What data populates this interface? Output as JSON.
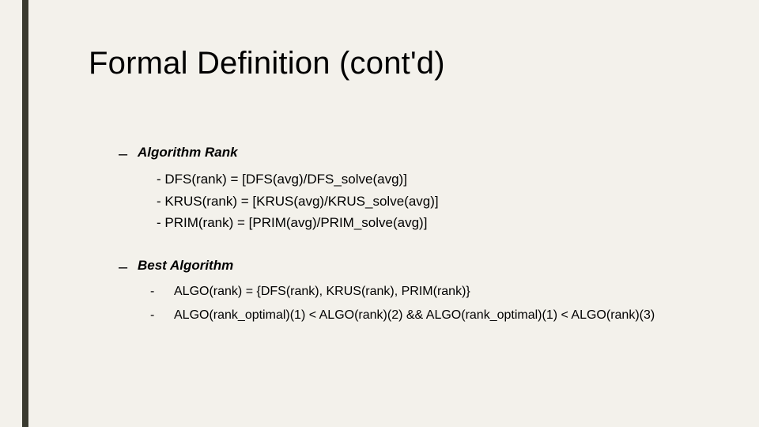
{
  "title": "Formal Definition (cont'd)",
  "section1": {
    "heading": "Algorithm Rank",
    "items": [
      "- DFS(rank) = [DFS(avg)/DFS_solve(avg)]",
      "- KRUS(rank) = [KRUS(avg)/KRUS_solve(avg)]",
      "- PRIM(rank) = [PRIM(avg)/PRIM_solve(avg)]"
    ]
  },
  "section2": {
    "heading": "Best Algorithm",
    "items": [
      "ALGO(rank) = {DFS(rank), KRUS(rank), PRIM(rank)}",
      "ALGO(rank_optimal)(1) < ALGO(rank)(2) && ALGO(rank_optimal)(1) < ALGO(rank)(3)"
    ]
  },
  "bullets": {
    "dash": "–",
    "hyphen": "-"
  }
}
